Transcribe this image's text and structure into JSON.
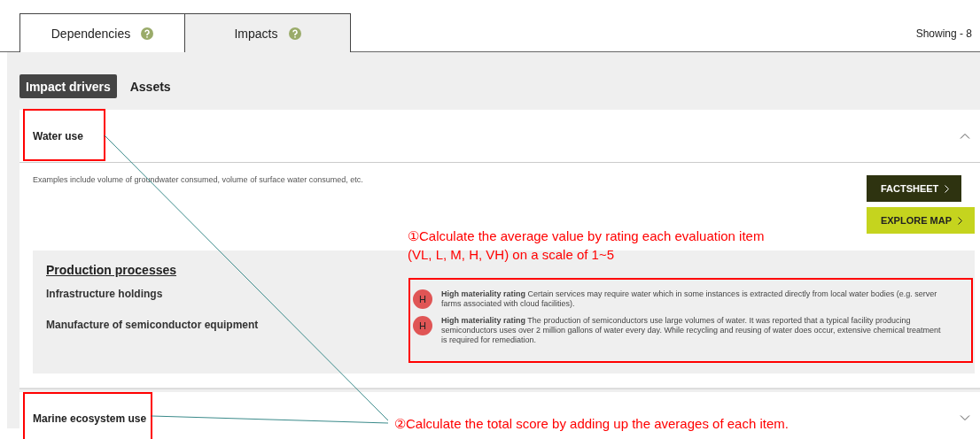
{
  "tabs": [
    {
      "label": "Dependencies",
      "selected": false
    },
    {
      "label": "Impacts",
      "selected": true
    }
  ],
  "showing": "Showing - 8",
  "subtabs": [
    {
      "label": "Impact drivers",
      "selected": true
    },
    {
      "label": "Assets",
      "selected": false
    }
  ],
  "accordions": [
    {
      "title": "Water use",
      "expanded": true,
      "description": "Examples include volume of groundwater consumed, volume of surface water consumed, etc.",
      "buttons": [
        {
          "label": "FACTSHEET",
          "kind": "dark"
        },
        {
          "label": "EXPLORE MAP",
          "kind": "lime"
        }
      ],
      "section": {
        "heading": "Production processes",
        "items": [
          "Infrastructure holdings",
          "Manufacture of semiconductor equipment"
        ],
        "ratings": [
          {
            "badge": "H",
            "label": "High materiality rating",
            "text": "Certain services may require water which in some instances is extracted directly from local water bodies (e.g. server farms associated with cloud facilities)."
          },
          {
            "badge": "H",
            "label": "High materiality rating",
            "text": "The production of semiconductors use large volumes of water. It was reported that a typical facility producing semiconductors uses over 2 million gallons of water every day. While recycling and reusing of water does occur, extensive chemical treatment is required for remediation."
          }
        ]
      }
    },
    {
      "title": "Marine ecosystem use",
      "expanded": false
    }
  ],
  "annotations": [
    {
      "number": "①",
      "lines": [
        "Calculate the average value by rating each evaluation item",
        "(VL, L, M, H, VH) on a scale of 1~5"
      ]
    },
    {
      "number": "②",
      "lines": [
        "Calculate the total score by adding up the averages of each item."
      ]
    }
  ]
}
